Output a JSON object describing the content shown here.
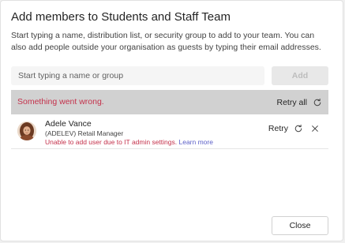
{
  "dialog": {
    "title": "Add members to Students and Staff Team",
    "description": "Start typing a name, distribution list, or security group to add to your team. You can also add people outside your organisation as guests by typing their email addresses.",
    "search": {
      "placeholder": "Start typing a name or group",
      "value": ""
    },
    "add_label": "Add",
    "error_bar": {
      "message": "Something went wrong.",
      "retry_all_label": "Retry all"
    },
    "members": [
      {
        "name": "Adele Vance",
        "role": "(ADELEV) Retail Manager",
        "error": "Unable to add user due to IT admin settings.",
        "learn_more": "Learn more",
        "retry_label": "Retry",
        "retry_icon": "refresh-icon",
        "remove_icon": "close-icon"
      }
    ],
    "close_label": "Close"
  },
  "colors": {
    "error_text": "#c4314b",
    "error_bar_bg": "#d1d1d1",
    "link": "#5b5fc7",
    "disabled_button_bg": "#e8e8e8"
  }
}
